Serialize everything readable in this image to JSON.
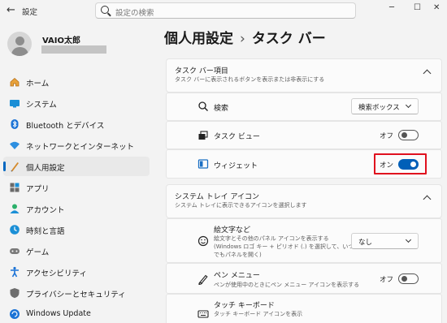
{
  "window": {
    "back_glyph": "←",
    "title": "設定",
    "controls": [
      "─",
      "☐",
      "✕"
    ]
  },
  "search": {
    "placeholder": "設定の検索"
  },
  "profile": {
    "name": "VAIO太郎"
  },
  "sidebar": {
    "items": [
      {
        "label": "ホーム",
        "icon": "home-icon"
      },
      {
        "label": "システム",
        "icon": "system-icon"
      },
      {
        "label": "Bluetooth とデバイス",
        "icon": "bluetooth-icon"
      },
      {
        "label": "ネットワークとインターネット",
        "icon": "network-icon"
      },
      {
        "label": "個人用設定",
        "icon": "personalization-icon",
        "selected": true
      },
      {
        "label": "アプリ",
        "icon": "apps-icon"
      },
      {
        "label": "アカウント",
        "icon": "account-icon"
      },
      {
        "label": "時刻と言語",
        "icon": "time-language-icon"
      },
      {
        "label": "ゲーム",
        "icon": "gaming-icon"
      },
      {
        "label": "アクセシビリティ",
        "icon": "accessibility-icon"
      },
      {
        "label": "プライバシーとセキュリティ",
        "icon": "privacy-shield-icon"
      },
      {
        "label": "Windows Update",
        "icon": "windows-update-icon"
      }
    ]
  },
  "page": {
    "breadcrumb_parent": "個人用設定",
    "breadcrumb_separator": "›",
    "breadcrumb_current": "タスク バー"
  },
  "taskbar_items": {
    "title": "タスク バー項目",
    "subtitle": "タスク バーに表示されるボタンを表示または非表示にする",
    "rows": {
      "search": {
        "label": "検索",
        "dropdown_value": "検索ボックス"
      },
      "taskview": {
        "label": "タスク ビュー",
        "state_label": "オフ",
        "on": false
      },
      "widgets": {
        "label": "ウィジェット",
        "state_label": "オン",
        "on": true
      }
    }
  },
  "tray_icons": {
    "title": "システム トレイ アイコン",
    "subtitle": "システム トレイに表示できるアイコンを選択します",
    "rows": {
      "emoji": {
        "label": "絵文字など",
        "desc1": "絵文字とその他のパネル アイコンを表示する",
        "desc2": "(Windows ロゴ キー + ピリオド (.) を選択して、いつ",
        "desc3": "でもパネルを開く)",
        "dropdown_value": "なし"
      },
      "pen": {
        "label": "ペン メニュー",
        "desc1": "ペンが使用中のときにペン メニュー アイコンを表示する",
        "state_label": "オフ",
        "on": false
      },
      "touch_keyboard": {
        "label": "タッチ キーボード",
        "desc1": "タッチ キーボード アイコンを表示"
      }
    }
  },
  "colors": {
    "accent": "#005fb8",
    "highlight": "#e0101e"
  }
}
